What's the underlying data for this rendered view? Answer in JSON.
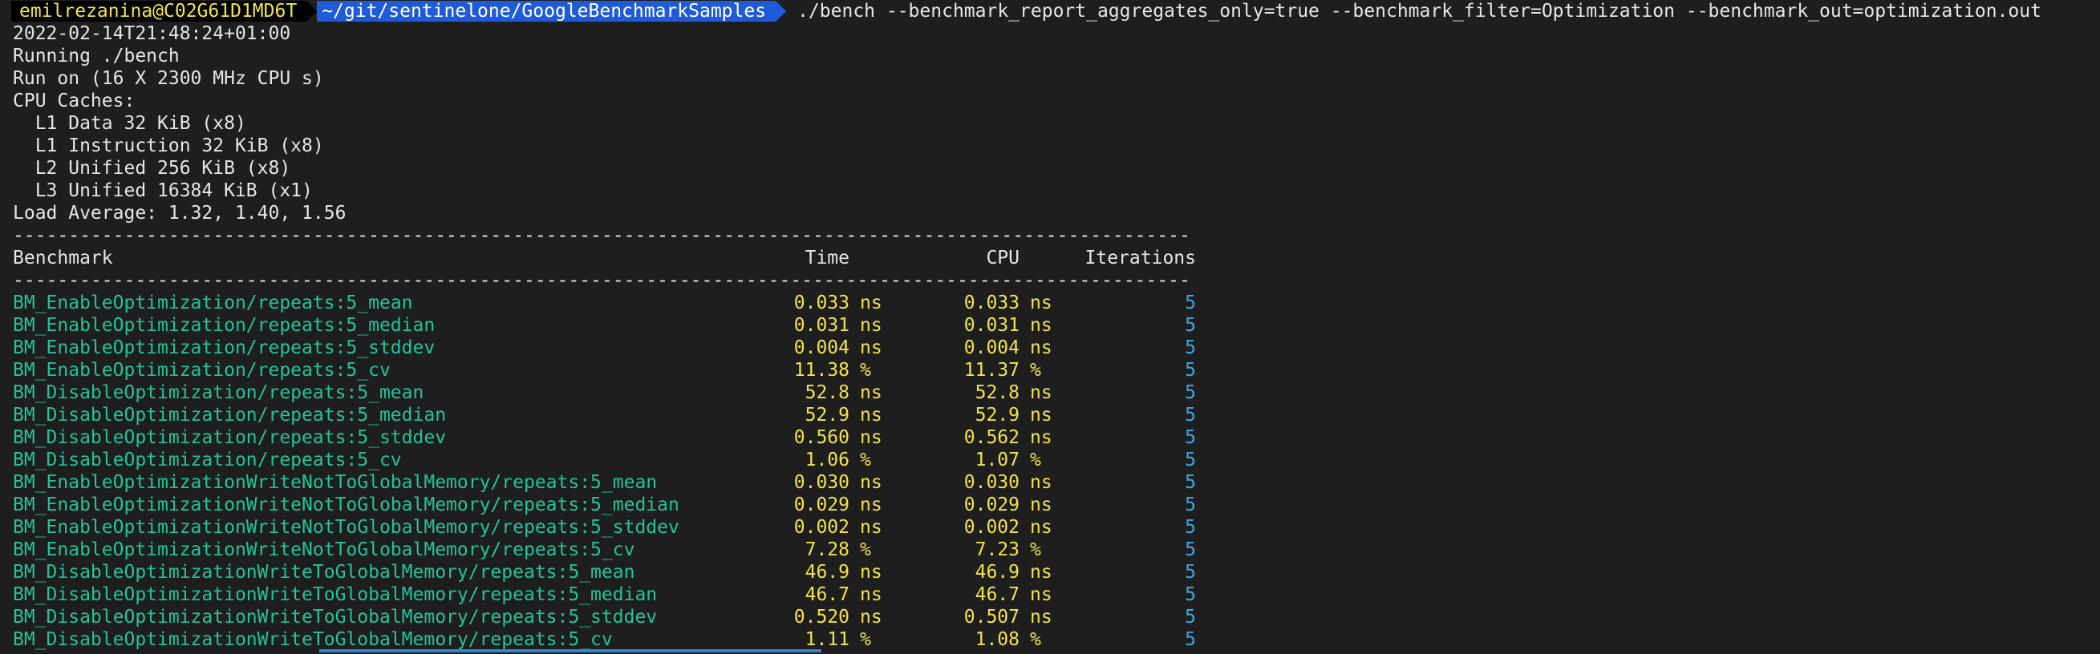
{
  "prompt": {
    "user_host": "emilrezanina@C02G61D1MD6T",
    "path": "~/git/sentinelone/GoogleBenchmarkSamples",
    "command": "./bench --benchmark_report_aggregates_only=true --benchmark_filter=Optimization --benchmark_out=optimization.out"
  },
  "info": [
    "2022-02-14T21:48:24+01:00",
    "Running ./bench",
    "Run on (16 X 2300 MHz CPU s)",
    "CPU Caches:",
    "  L1 Data 32 KiB (x8)",
    "  L1 Instruction 32 KiB (x8)",
    "  L2 Unified 256 KiB (x8)",
    "  L3 Unified 16384 KiB (x1)",
    "Load Average: 1.32, 1.40, 1.56"
  ],
  "separator": "----------------------------------------------------------------------------------------------------------",
  "table": {
    "headers": {
      "benchmark": "Benchmark",
      "time": "Time",
      "cpu": "CPU",
      "iterations": "Iterations"
    },
    "rows": [
      {
        "name": "BM_EnableOptimization/repeats:5_mean",
        "time": "0.033",
        "time_unit": "ns",
        "cpu": "0.033",
        "cpu_unit": "ns",
        "iter": "5"
      },
      {
        "name": "BM_EnableOptimization/repeats:5_median",
        "time": "0.031",
        "time_unit": "ns",
        "cpu": "0.031",
        "cpu_unit": "ns",
        "iter": "5"
      },
      {
        "name": "BM_EnableOptimization/repeats:5_stddev",
        "time": "0.004",
        "time_unit": "ns",
        "cpu": "0.004",
        "cpu_unit": "ns",
        "iter": "5"
      },
      {
        "name": "BM_EnableOptimization/repeats:5_cv",
        "time": "11.38",
        "time_unit": "%",
        "cpu": "11.37",
        "cpu_unit": "%",
        "iter": "5"
      },
      {
        "name": "BM_DisableOptimization/repeats:5_mean",
        "time": "52.8",
        "time_unit": "ns",
        "cpu": "52.8",
        "cpu_unit": "ns",
        "iter": "5"
      },
      {
        "name": "BM_DisableOptimization/repeats:5_median",
        "time": "52.9",
        "time_unit": "ns",
        "cpu": "52.9",
        "cpu_unit": "ns",
        "iter": "5"
      },
      {
        "name": "BM_DisableOptimization/repeats:5_stddev",
        "time": "0.560",
        "time_unit": "ns",
        "cpu": "0.562",
        "cpu_unit": "ns",
        "iter": "5"
      },
      {
        "name": "BM_DisableOptimization/repeats:5_cv",
        "time": "1.06",
        "time_unit": "%",
        "cpu": "1.07",
        "cpu_unit": "%",
        "iter": "5"
      },
      {
        "name": "BM_EnableOptimizationWriteNotToGlobalMemory/repeats:5_mean",
        "time": "0.030",
        "time_unit": "ns",
        "cpu": "0.030",
        "cpu_unit": "ns",
        "iter": "5"
      },
      {
        "name": "BM_EnableOptimizationWriteNotToGlobalMemory/repeats:5_median",
        "time": "0.029",
        "time_unit": "ns",
        "cpu": "0.029",
        "cpu_unit": "ns",
        "iter": "5"
      },
      {
        "name": "BM_EnableOptimizationWriteNotToGlobalMemory/repeats:5_stddev",
        "time": "0.002",
        "time_unit": "ns",
        "cpu": "0.002",
        "cpu_unit": "ns",
        "iter": "5"
      },
      {
        "name": "BM_EnableOptimizationWriteNotToGlobalMemory/repeats:5_cv",
        "time": "7.28",
        "time_unit": "%",
        "cpu": "7.23",
        "cpu_unit": "%",
        "iter": "5"
      },
      {
        "name": "BM_DisableOptimizationWriteToGlobalMemory/repeats:5_mean",
        "time": "46.9",
        "time_unit": "ns",
        "cpu": "46.9",
        "cpu_unit": "ns",
        "iter": "5"
      },
      {
        "name": "BM_DisableOptimizationWriteToGlobalMemory/repeats:5_median",
        "time": "46.7",
        "time_unit": "ns",
        "cpu": "46.7",
        "cpu_unit": "ns",
        "iter": "5"
      },
      {
        "name": "BM_DisableOptimizationWriteToGlobalMemory/repeats:5_stddev",
        "time": "0.520",
        "time_unit": "ns",
        "cpu": "0.507",
        "cpu_unit": "ns",
        "iter": "5"
      },
      {
        "name": "BM_DisableOptimizationWriteToGlobalMemory/repeats:5_cv",
        "time": "1.11",
        "time_unit": "%",
        "cpu": "1.08",
        "cpu_unit": "%",
        "iter": "5"
      }
    ]
  },
  "colors": {
    "background": "#1e1e1e",
    "benchmark_name": "#21c39a",
    "value": "#f2e34b",
    "iterations": "#3aa8e8",
    "path_segment": "#1f5bd8"
  }
}
